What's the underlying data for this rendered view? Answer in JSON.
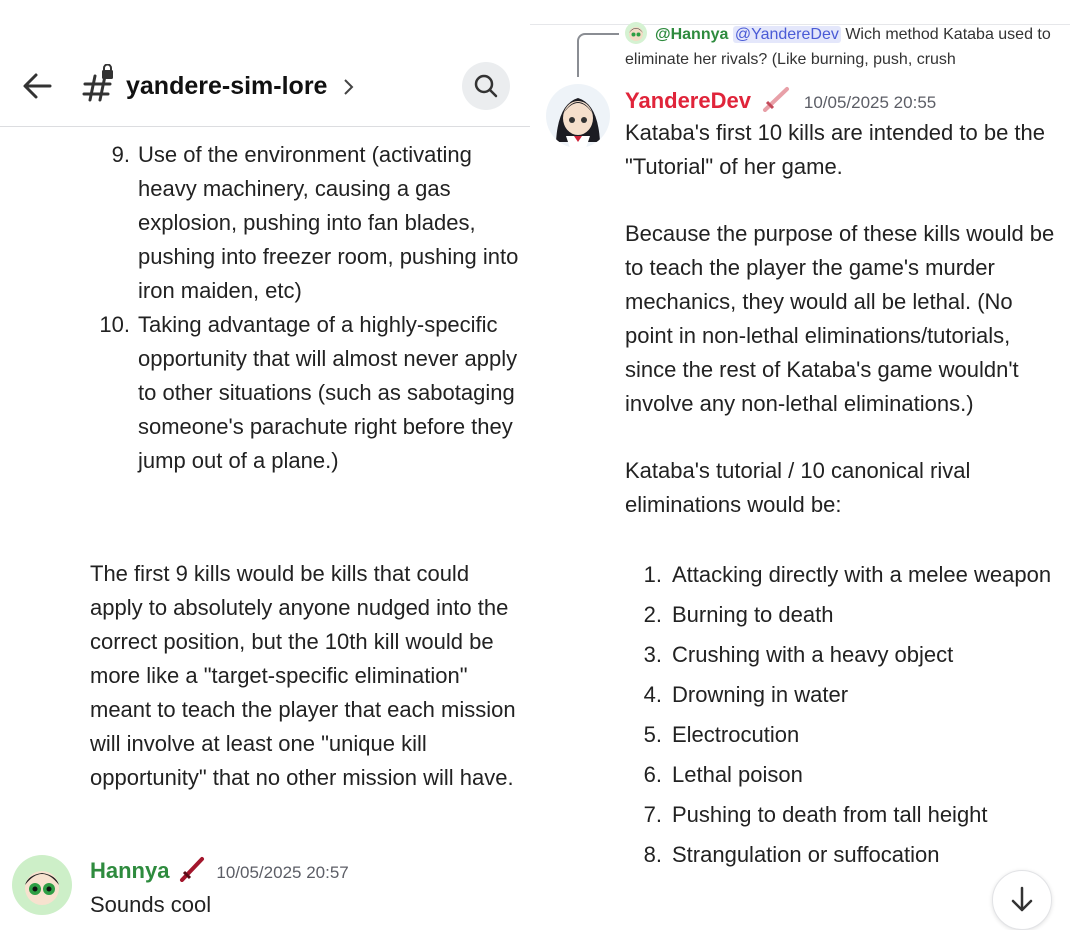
{
  "header": {
    "channel": "yandere-sim-lore"
  },
  "left_list": [
    {
      "num": "9.",
      "text": "Use of the environment (activating heavy machinery, causing a gas explosion, pushing into fan blades, pushing into freezer room, pushing into iron maiden, etc)"
    },
    {
      "num": "10.",
      "text": "Taking advantage of a highly-specific opportunity that will almost never apply to other situations (such as sabotaging someone's parachute right before they jump out of a plane.)"
    }
  ],
  "left_paragraph": "The first 9 kills would be kills that could apply to absolutely anyone nudged into the correct position, but the 10th kill would be more like a \"target-specific elimination\" meant to teach the player that each mission will involve at least one \"unique kill opportunity\" that no other mission will have.",
  "hannya_message": {
    "username": "Hannya",
    "username_color": "#2e8b3e",
    "timestamp": "10/05/2025 20:57",
    "text": "Sounds cool"
  },
  "reply": {
    "author": "@Hannya",
    "mention": "@YandereDev",
    "text": "Wich method Kataba used to eliminate her rivals? (Like burning, push, crush"
  },
  "dev_message": {
    "username": "YandereDev",
    "username_color": "#e0243a",
    "timestamp": "10/05/2025 20:55",
    "p1": "Kataba's first 10 kills are intended to be the \"Tutorial\" of her game.",
    "p2": "Because the purpose of these kills would be to teach the player the game's murder mechanics, they would all be lethal. (No point in non-lethal eliminations/tutorials, since the rest of Kataba's game wouldn't involve any non-lethal eliminations.)",
    "p3": "Kataba's tutorial / 10 canonical rival eliminations would be:"
  },
  "right_list": [
    {
      "num": "1.",
      "text": "Attacking directly with a melee weapon"
    },
    {
      "num": "2.",
      "text": "Burning to death"
    },
    {
      "num": "3.",
      "text": "Crushing with a heavy object"
    },
    {
      "num": "4.",
      "text": "Drowning in water"
    },
    {
      "num": "5.",
      "text": "Electrocution"
    },
    {
      "num": "6.",
      "text": "Lethal poison"
    },
    {
      "num": "7.",
      "text": "Pushing to death from tall height"
    },
    {
      "num": "8.",
      "text": "Strangulation or suffocation"
    }
  ],
  "icons": [
    "back-arrow-icon",
    "channel-hash-lock-icon",
    "chevron-right-icon",
    "search-icon",
    "sword-badge-icon",
    "scroll-down-icon"
  ]
}
